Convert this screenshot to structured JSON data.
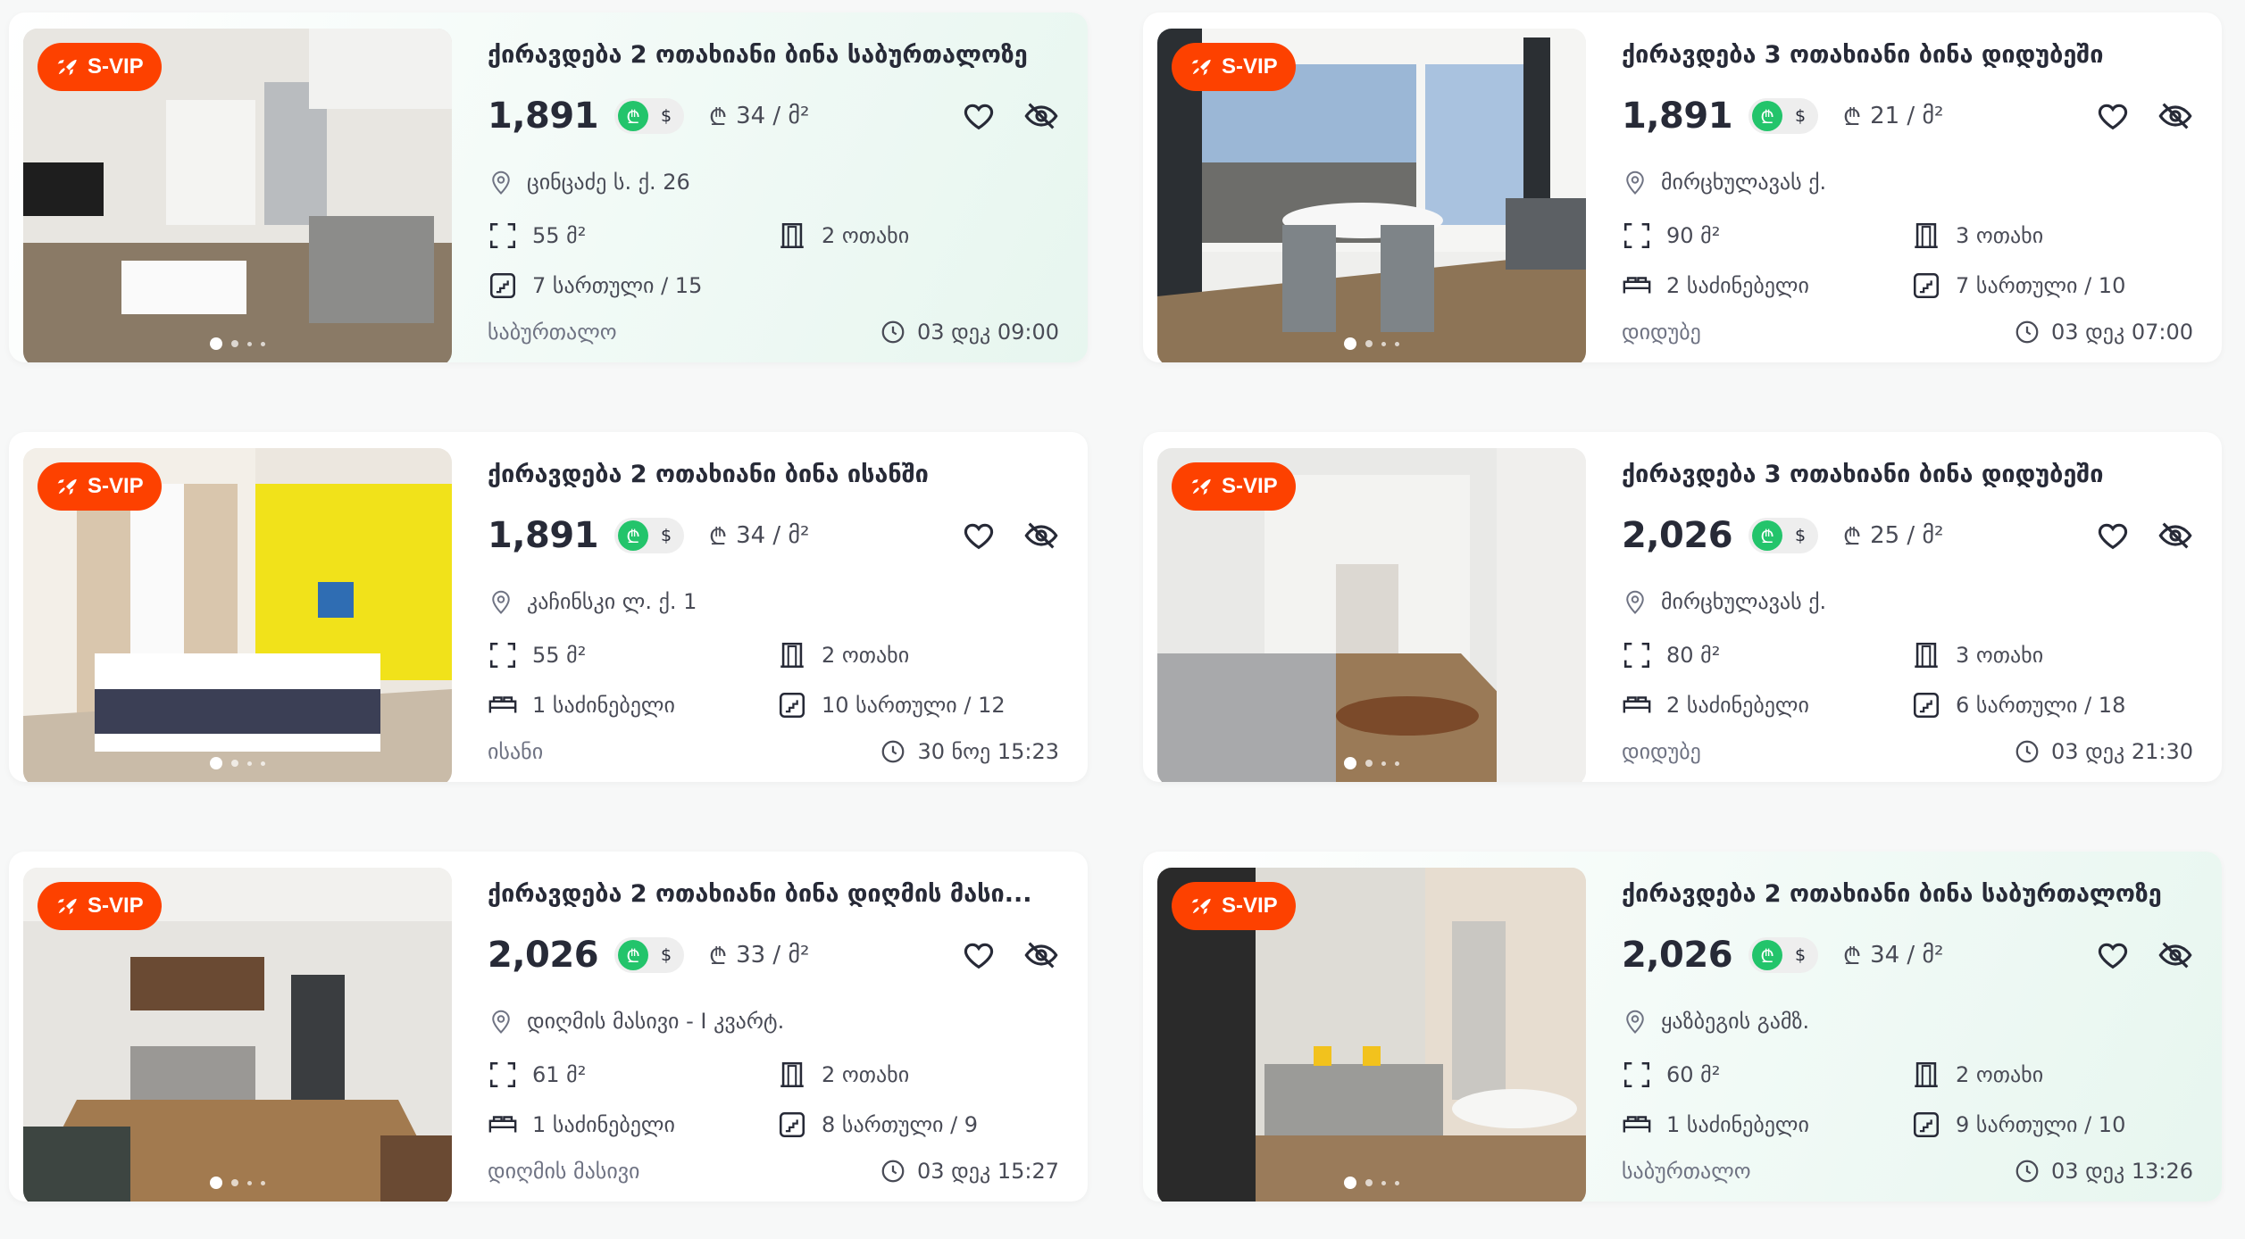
{
  "colors": {
    "badge_bg": "#fd4100",
    "lari_green": "#23c46b",
    "text_dark": "#272a37",
    "text_muted": "#6f7383"
  },
  "icons": {
    "badge": "rocket-icon",
    "fav": "heart-icon",
    "hide": "eye-off-icon",
    "location": "pin-icon",
    "area": "area-icon",
    "rooms": "door-icon",
    "bedrooms": "bed-icon",
    "floor": "stairs-icon",
    "time": "clock-icon"
  },
  "listings": [
    {
      "badge": "S-VIP",
      "title": "ქირავდება 2 ოთახიანი ბინა საბურთალოზე",
      "price": "1,891",
      "currency_gel": "₾",
      "currency_usd": "$",
      "price_per_m": "34 / მ²",
      "address": "ცინცაძე ს. ქ. 26",
      "area": "55 მ²",
      "rooms": "2 ოთახი",
      "bedrooms": "",
      "floor": "7 სართული / 15",
      "district": "საბურთალო",
      "date": "03 დეკ 09:00",
      "photo": {
        "slide": 1,
        "slides": 4
      }
    },
    {
      "badge": "S-VIP",
      "title": "ქირავდება 3 ოთახიანი ბინა დიდუბეში",
      "price": "1,891",
      "currency_gel": "₾",
      "currency_usd": "$",
      "price_per_m": "21 / მ²",
      "address": "მირცხულავას ქ.",
      "area": "90 მ²",
      "rooms": "3 ოთახი",
      "bedrooms": "2 საძინებელი",
      "floor": "7 სართული / 10",
      "district": "დიდუბე",
      "date": "03 დეკ 07:00",
      "photo": {
        "slide": 1,
        "slides": 4
      }
    },
    {
      "badge": "S-VIP",
      "title": "ქირავდება 2 ოთახიანი ბინა ისანში",
      "price": "1,891",
      "currency_gel": "₾",
      "currency_usd": "$",
      "price_per_m": "34 / მ²",
      "address": "კაჩინსკი ლ. ქ. 1",
      "area": "55 მ²",
      "rooms": "2 ოთახი",
      "bedrooms": "1 საძინებელი",
      "floor": "10 სართული / 12",
      "district": "ისანი",
      "date": "30 ნოე 15:23",
      "photo": {
        "slide": 1,
        "slides": 4
      }
    },
    {
      "badge": "S-VIP",
      "title": "ქირავდება 3 ოთახიანი ბინა დიდუბეში",
      "price": "2,026",
      "currency_gel": "₾",
      "currency_usd": "$",
      "price_per_m": "25 / მ²",
      "address": "მირცხულავას ქ.",
      "area": "80 მ²",
      "rooms": "3 ოთახი",
      "bedrooms": "2 საძინებელი",
      "floor": "6 სართული / 18",
      "district": "დიდუბე",
      "date": "03 დეკ 21:30",
      "photo": {
        "slide": 1,
        "slides": 4
      }
    },
    {
      "badge": "S-VIP",
      "title": "ქირავდება 2 ოთახიანი ბინა დიღმის მასი...",
      "price": "2,026",
      "currency_gel": "₾",
      "currency_usd": "$",
      "price_per_m": "33 / მ²",
      "address": "დიღმის მასივი - I კვარტ.",
      "area": "61 მ²",
      "rooms": "2 ოთახი",
      "bedrooms": "1 საძინებელი",
      "floor": "8 სართული / 9",
      "district": "დიღმის მასივი",
      "date": "03 დეკ 15:27",
      "photo": {
        "slide": 1,
        "slides": 4
      }
    },
    {
      "badge": "S-VIP",
      "title": "ქირავდება 2 ოთახიანი ბინა საბურთალოზე",
      "price": "2,026",
      "currency_gel": "₾",
      "currency_usd": "$",
      "price_per_m": "34 / მ²",
      "address": "ყაზბეგის გამზ.",
      "area": "60 მ²",
      "rooms": "2 ოთახი",
      "bedrooms": "1 საძინებელი",
      "floor": "9 სართული / 10",
      "district": "საბურთალო",
      "date": "03 დეკ 13:26",
      "photo": {
        "slide": 1,
        "slides": 4
      }
    }
  ]
}
